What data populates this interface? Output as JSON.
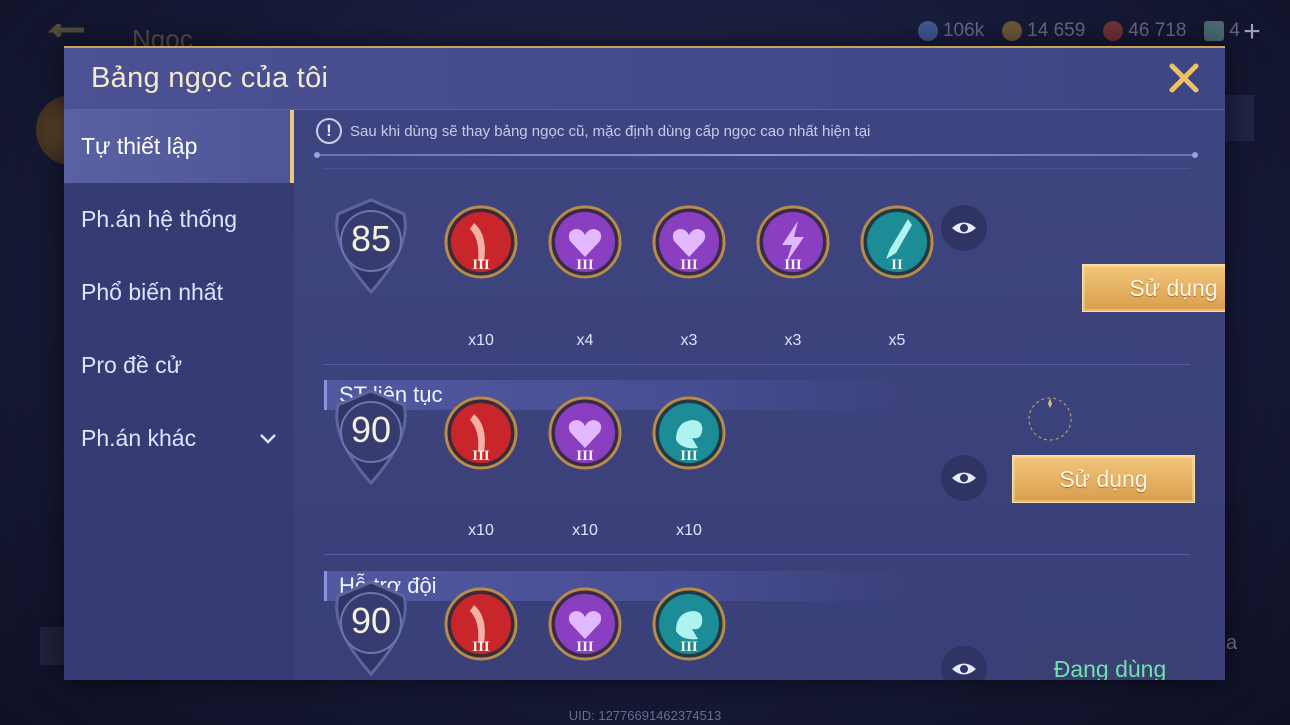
{
  "background": {
    "title": "Ngọc",
    "currencies": [
      {
        "icon": "diamond-icon",
        "value": "106k",
        "color": "#6fa6ff"
      },
      {
        "icon": "gold-coin-icon",
        "value": "14 659",
        "color": "#d9a53a"
      },
      {
        "icon": "ruby-icon",
        "value": "46 718",
        "color": "#e0533a"
      },
      {
        "icon": "card-icon",
        "value": "4",
        "color": "#8fd3c8"
      }
    ],
    "plus": "+",
    "right_text": "a",
    "uid": "UID: 12776691462374513"
  },
  "modal": {
    "title": "Bảng ngọc của tôi"
  },
  "sidebar": {
    "items": [
      {
        "label": "Tự thiết lập",
        "active": true
      },
      {
        "label": "Ph.án hệ thống",
        "active": false
      },
      {
        "label": "Phổ biến nhất",
        "active": false
      },
      {
        "label": "Pro đề cử",
        "active": false
      },
      {
        "label": "Ph.án khác",
        "active": false
      }
    ]
  },
  "notice": {
    "text": "Sau khi dùng sẽ thay bảng ngọc cũ, mặc định dùng cấp ngọc cao nhất hiện tại"
  },
  "setups": [
    {
      "name": "",
      "level": "85",
      "button": "Sử dụng",
      "in_use": false,
      "gems": [
        {
          "type": "red",
          "icon": "attack-gem-icon",
          "tier": "III",
          "count": "x10"
        },
        {
          "type": "purple",
          "icon": "heart-gem-icon",
          "tier": "III",
          "count": "x4"
        },
        {
          "type": "purple",
          "icon": "heart-gem-icon",
          "tier": "III",
          "count": "x3"
        },
        {
          "type": "purple",
          "icon": "lightning-gem-icon",
          "tier": "III",
          "count": "x3"
        },
        {
          "type": "teal",
          "icon": "blade-gem-icon",
          "tier": "II",
          "count": "x5"
        }
      ]
    },
    {
      "name": "ST liên tục",
      "level": "90",
      "button": "Sử dụng",
      "in_use": false,
      "gems": [
        {
          "type": "red",
          "icon": "attack-gem-icon",
          "tier": "III",
          "count": "x10"
        },
        {
          "type": "purple",
          "icon": "heart-gem-icon",
          "tier": "III",
          "count": "x10"
        },
        {
          "type": "teal",
          "icon": "swirl-gem-icon",
          "tier": "III",
          "count": "x10"
        }
      ]
    },
    {
      "name": "Hỗ trợ đội",
      "level": "90",
      "button": "Đang dùng",
      "in_use": true,
      "gems": [
        {
          "type": "red",
          "icon": "attack-gem-icon",
          "tier": "III",
          "count": ""
        },
        {
          "type": "purple",
          "icon": "heart-gem-icon",
          "tier": "III",
          "count": ""
        },
        {
          "type": "teal",
          "icon": "swirl-gem-icon",
          "tier": "III",
          "count": ""
        }
      ]
    }
  ],
  "colors": {
    "accent_gold": "#e7c97f",
    "gem_red": "#c8262a",
    "gem_purple": "#8a3fc0",
    "gem_teal": "#1c8c96",
    "in_use_green": "#6ee3a6"
  }
}
